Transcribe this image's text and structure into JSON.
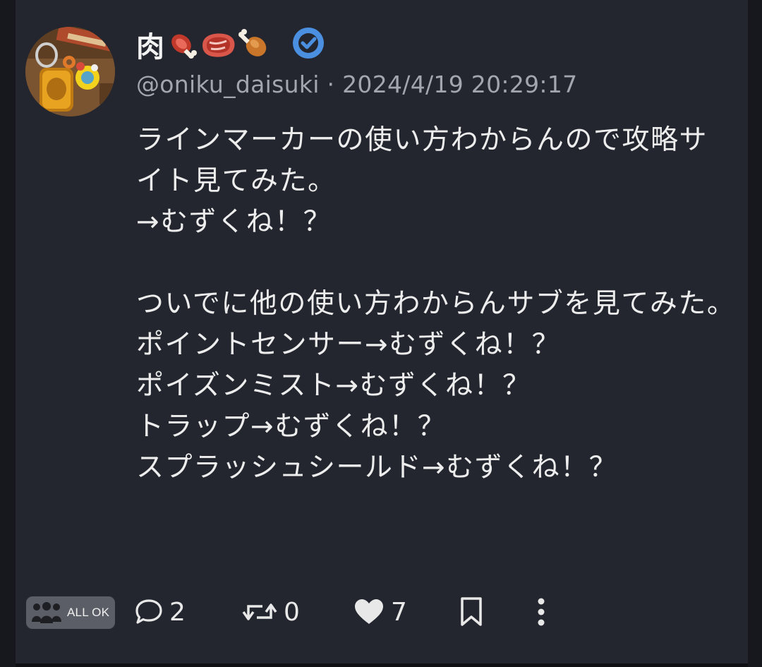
{
  "author": {
    "display_name": "肉",
    "handle": "@oniku_daisuki",
    "separator": "·",
    "timestamp": "2024/4/19 20:29:17",
    "verified": true,
    "name_emoji_icons": [
      "meat-on-bone-icon",
      "cut-of-meat-icon",
      "poultry-leg-icon"
    ]
  },
  "post": {
    "text": "ラインマーカーの使い方わからんので攻略サイト見てみた。\n→むずくね！？\n\nついでに他の使い方わからんサブを見てみた。\nポイントセンサー→むずくね！？\nポイズンミスト→むずくね！？\nトラップ→むずくね！？\nスプラッシュシールド→むずくね！？"
  },
  "footer": {
    "visibility_label": "ALL OK",
    "reply_count": "2",
    "renote_count": "0",
    "like_count": "7"
  },
  "colors": {
    "background": "#23262e",
    "text": "#ededed",
    "muted": "#a3a6ae",
    "verified": "#4a8fe0"
  }
}
